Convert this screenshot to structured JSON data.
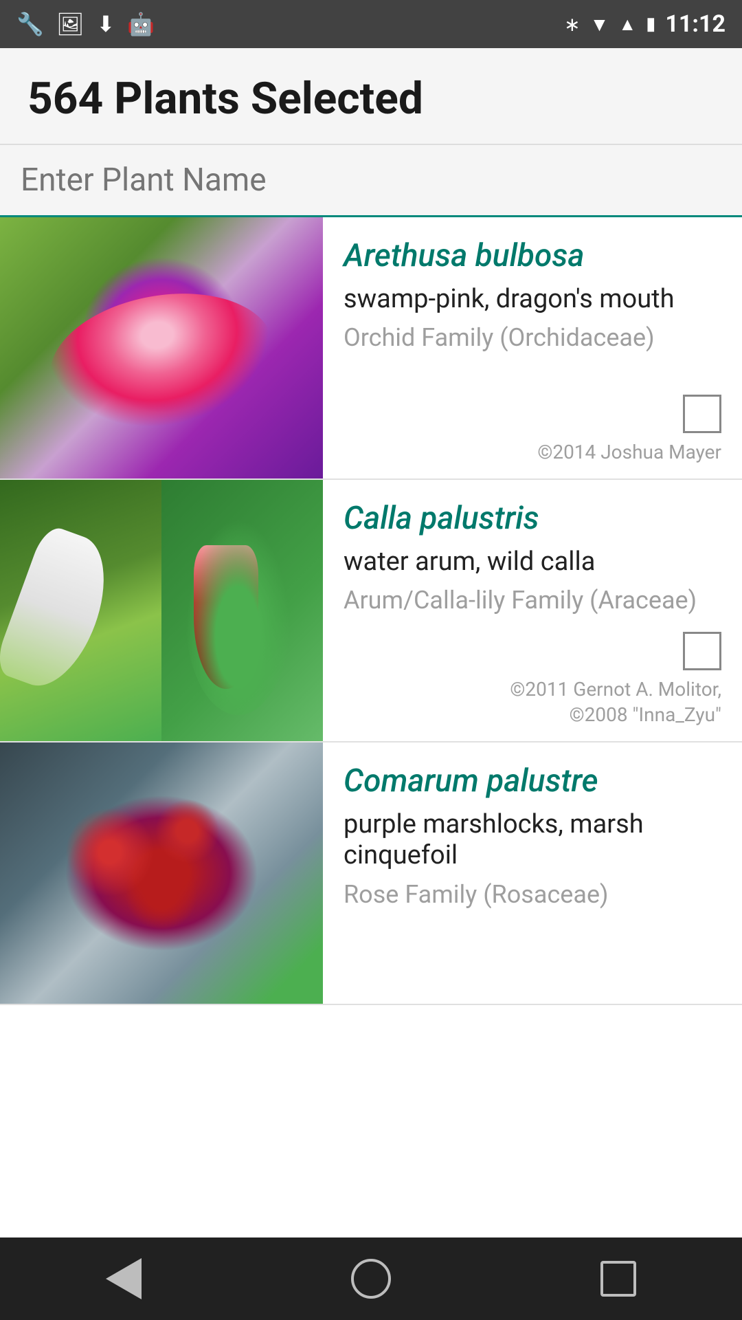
{
  "status_bar": {
    "time": "11:12",
    "icons_left": [
      "wrench-icon",
      "image-icon",
      "download-icon",
      "android-icon"
    ],
    "icons_right": [
      "bluetooth-icon",
      "wifi-icon",
      "signal-icon",
      "battery-icon"
    ]
  },
  "header": {
    "title": "564 Plants Selected"
  },
  "search": {
    "placeholder": "Enter Plant Name",
    "value": ""
  },
  "plants": [
    {
      "id": 1,
      "scientific_name": "Arethusa bulbosa",
      "common_name": "swamp-pink, dragon's mouth",
      "family": "Orchid Family (Orchidaceae)",
      "copyright": "©2014 Joshua Mayer",
      "checked": false,
      "image_count": 1
    },
    {
      "id": 2,
      "scientific_name": "Calla palustris",
      "common_name": "water arum, wild calla",
      "family": "Arum/Calla-lily Family (Araceae)",
      "copyright": "©2011 Gernot A. Molitor,\n©2008 \"Inna_Zyu\"",
      "copyright_line1": "©2011 Gernot A. Molitor,",
      "copyright_line2": "©2008 \"Inna_Zyu\"",
      "checked": false,
      "image_count": 2
    },
    {
      "id": 3,
      "scientific_name": "Comarum palustre",
      "common_name": "purple marshlocks, marsh cinquefoil",
      "family": "Rose Family (Rosaceae)",
      "copyright": "",
      "checked": false,
      "image_count": 1
    }
  ],
  "nav": {
    "back_label": "Back",
    "home_label": "Home",
    "recents_label": "Recents"
  }
}
